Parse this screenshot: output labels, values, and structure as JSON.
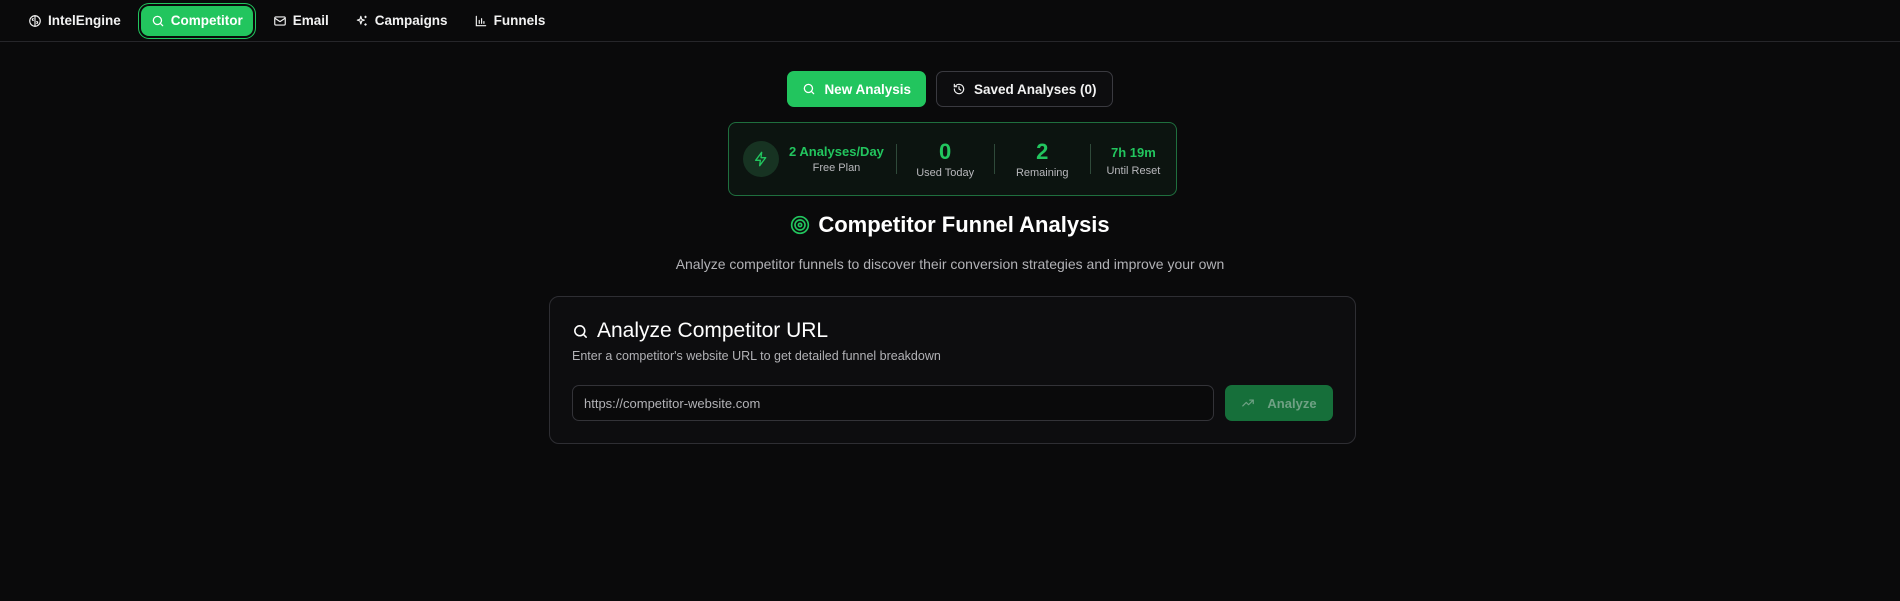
{
  "nav": {
    "items": [
      {
        "label": "IntelEngine",
        "icon": "brain-icon"
      },
      {
        "label": "Competitor",
        "icon": "search-icon",
        "active": true
      },
      {
        "label": "Email",
        "icon": "mail-icon"
      },
      {
        "label": "Campaigns",
        "icon": "sparkles-icon"
      },
      {
        "label": "Funnels",
        "icon": "bar-chart-icon"
      }
    ]
  },
  "actions": {
    "new_analysis": "New Analysis",
    "saved_analyses": "Saved Analyses (0)"
  },
  "usage": {
    "plan_title": "2 Analyses/Day",
    "plan_name": "Free Plan",
    "used_value": "0",
    "used_label": "Used Today",
    "remaining_value": "2",
    "remaining_label": "Remaining",
    "reset_value": "7h 19m",
    "reset_label": "Until Reset"
  },
  "header": {
    "title": "Competitor Funnel Analysis",
    "subtitle": "Analyze competitor funnels to discover their conversion strategies and improve your own"
  },
  "analyze_card": {
    "title": "Analyze Competitor URL",
    "description": "Enter a competitor's website URL to get detailed funnel breakdown",
    "url_placeholder": "https://competitor-website.com",
    "url_value": "",
    "button_label": "Analyze"
  },
  "colors": {
    "accent": "#22c55e",
    "background": "#0a0a0b",
    "card": "#0d0d0f",
    "disabled_button": "#166f3a"
  }
}
